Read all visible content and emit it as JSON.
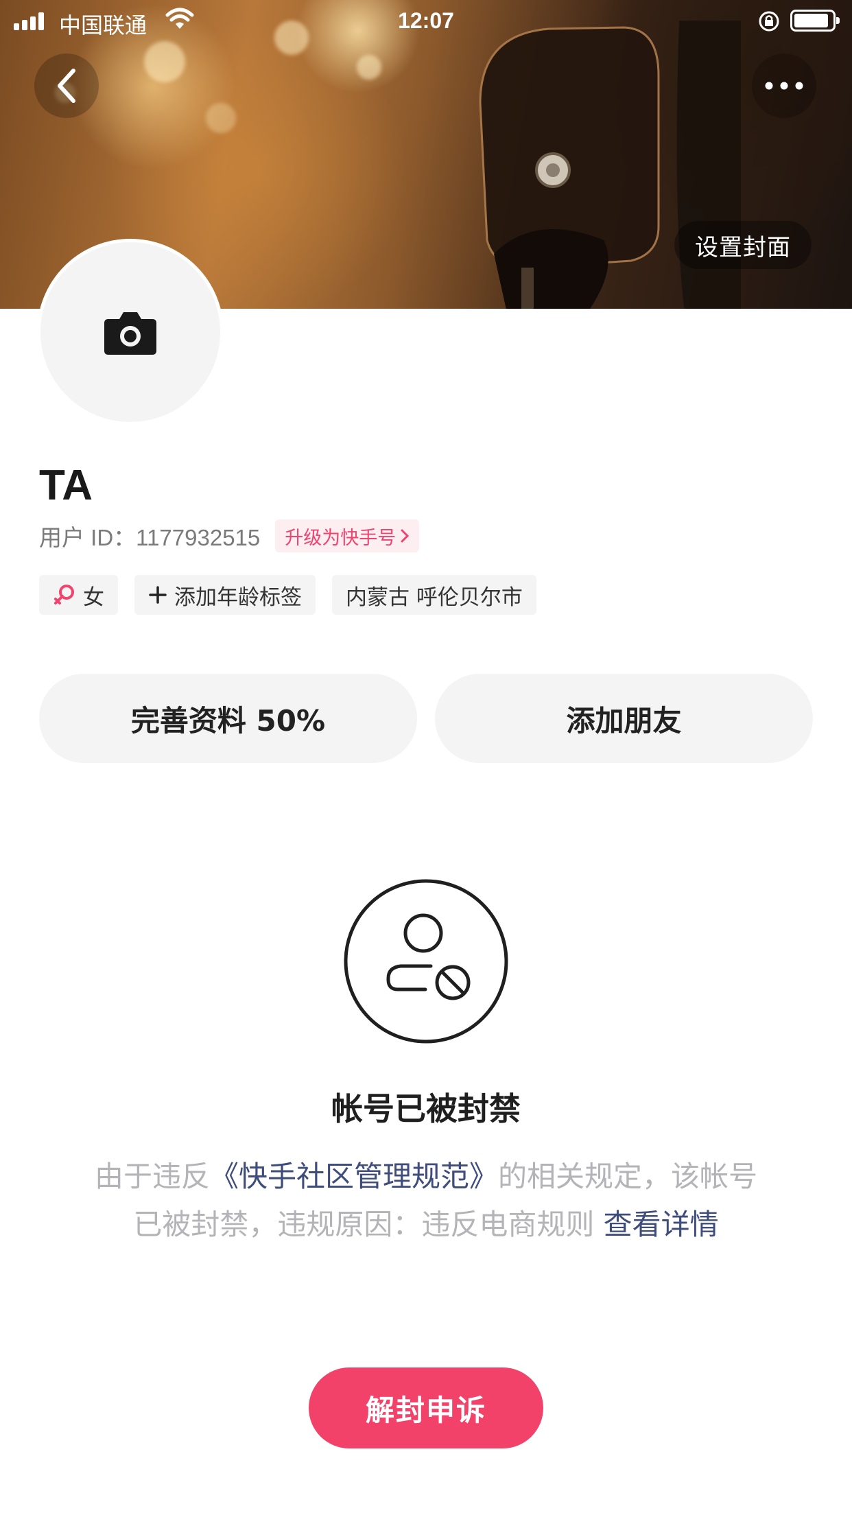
{
  "status_bar": {
    "carrier": "中国联通",
    "time": "12:07",
    "battery_level": 0.9
  },
  "header": {
    "back_icon": "chevron-left-icon",
    "more_icon": "more-dots-icon",
    "set_cover_label": "设置封面"
  },
  "avatar": {
    "icon": "camera-icon"
  },
  "profile": {
    "name": "TA",
    "user_id": "用户 ID：1177932515",
    "upgrade_label": "升级为快手号",
    "tags": {
      "gender": "女",
      "age": "添加年龄标签",
      "location": "内蒙古 呼伦贝尔市"
    }
  },
  "actions": {
    "complete_profile": "完善资料 50%",
    "add_friends": "添加朋友"
  },
  "banned": {
    "icon": "user-banned-icon",
    "title": "帐号已被封禁",
    "desc_prefix": "由于违反",
    "rule_link": "《快手社区管理规范》",
    "desc_middle": "的相关规定，该帐号已被封禁，违规原因：违反电商规则 ",
    "detail_link": "查看详情",
    "appeal_button": "解封申诉"
  },
  "colors": {
    "accent": "#f2426a",
    "link": "#3f4d7c",
    "muted_text": "#b4b4b8",
    "chip_bg": "#f4f4f5"
  }
}
